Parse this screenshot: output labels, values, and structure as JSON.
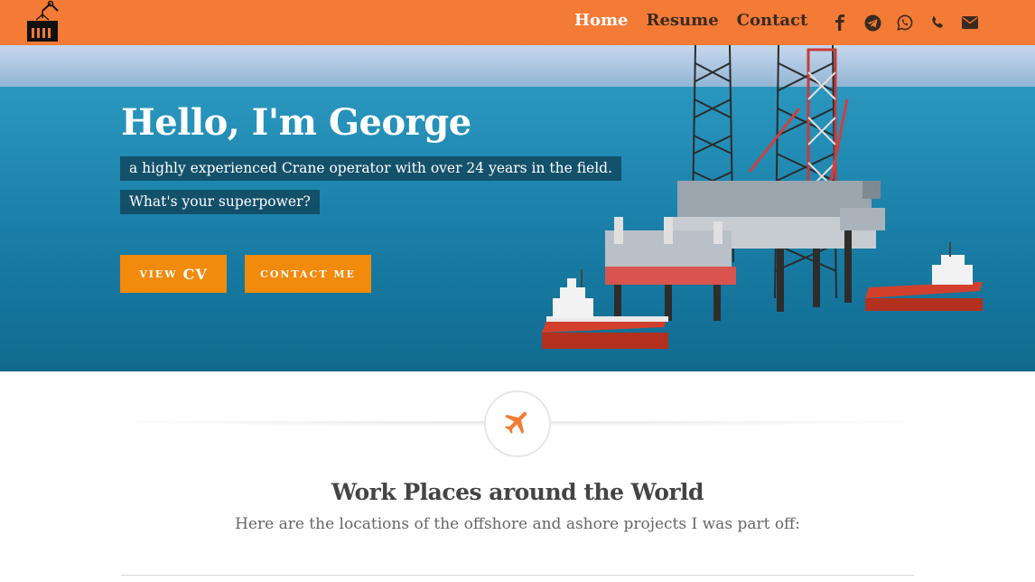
{
  "nav": {
    "links": [
      {
        "label": "Home",
        "active": true
      },
      {
        "label": "Resume",
        "active": false
      },
      {
        "label": "Contact",
        "active": false
      }
    ],
    "social_icons": [
      "facebook-icon",
      "telegram-icon",
      "whatsapp-icon",
      "phone-icon",
      "envelope-icon"
    ],
    "logo_icon": "crane-container-icon"
  },
  "hero": {
    "title": "Hello, I'm George",
    "line1": "a highly experienced Crane operator with over 24 years in the field.",
    "line2": "What's your superpower?",
    "btn_cv_small": "VIEW",
    "btn_cv_big": "CV",
    "btn_contact": "CONTACT ME"
  },
  "section": {
    "icon": "airplane-icon",
    "title": "Work Places around the World",
    "subtitle": "Here are the locations of the offshore and ashore projects I was part off:"
  },
  "colors": {
    "navbar": "#f47b35",
    "button": "#f28a0c",
    "plane": "#f47b35"
  }
}
